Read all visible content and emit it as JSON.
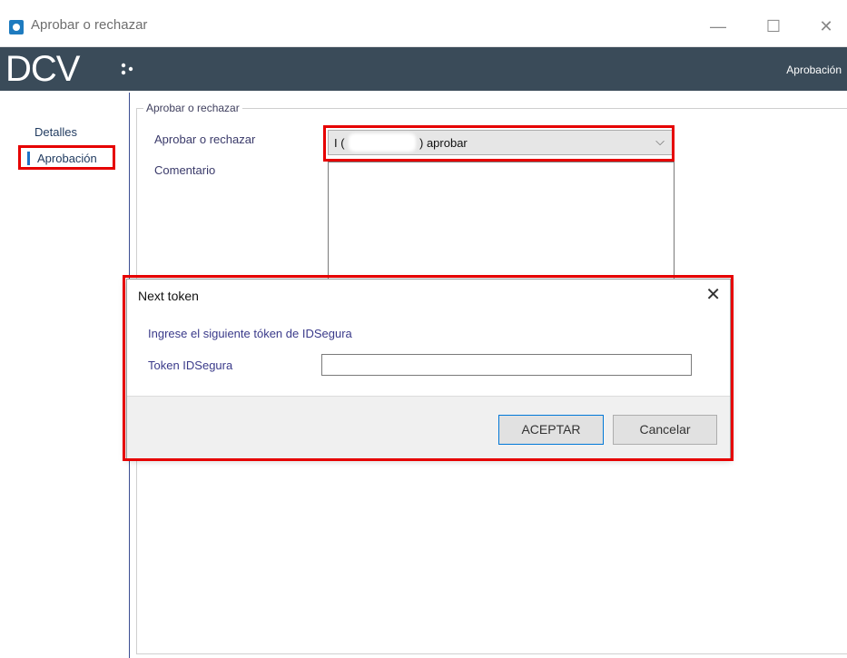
{
  "window": {
    "title": "Aprobar o rechazar",
    "minimize": "—",
    "maximize": "☐",
    "close": "✕"
  },
  "header": {
    "logo": "DCV",
    "section": "Aprobación",
    "color": "#3a4b59"
  },
  "nav": {
    "items": [
      {
        "label": "Detalles"
      },
      {
        "label": "Aprobación",
        "active": true
      }
    ]
  },
  "form": {
    "group_title": "Aprobar o rechazar",
    "approve_label": "Aprobar o rechazar",
    "approve_value_prefix": "I (",
    "approve_value_suffix": ") aprobar",
    "comment_label": "Comentario"
  },
  "modal": {
    "title": "Next token",
    "close": "✕",
    "message": "Ingrese el siguiente tóken de IDSegura",
    "token_label": "Token IDSegura",
    "token_value": "",
    "ok_label": "ACEPTAR",
    "cancel_label": "Cancelar"
  },
  "colors": {
    "highlight": "#e60000",
    "accent": "#0078d7"
  }
}
